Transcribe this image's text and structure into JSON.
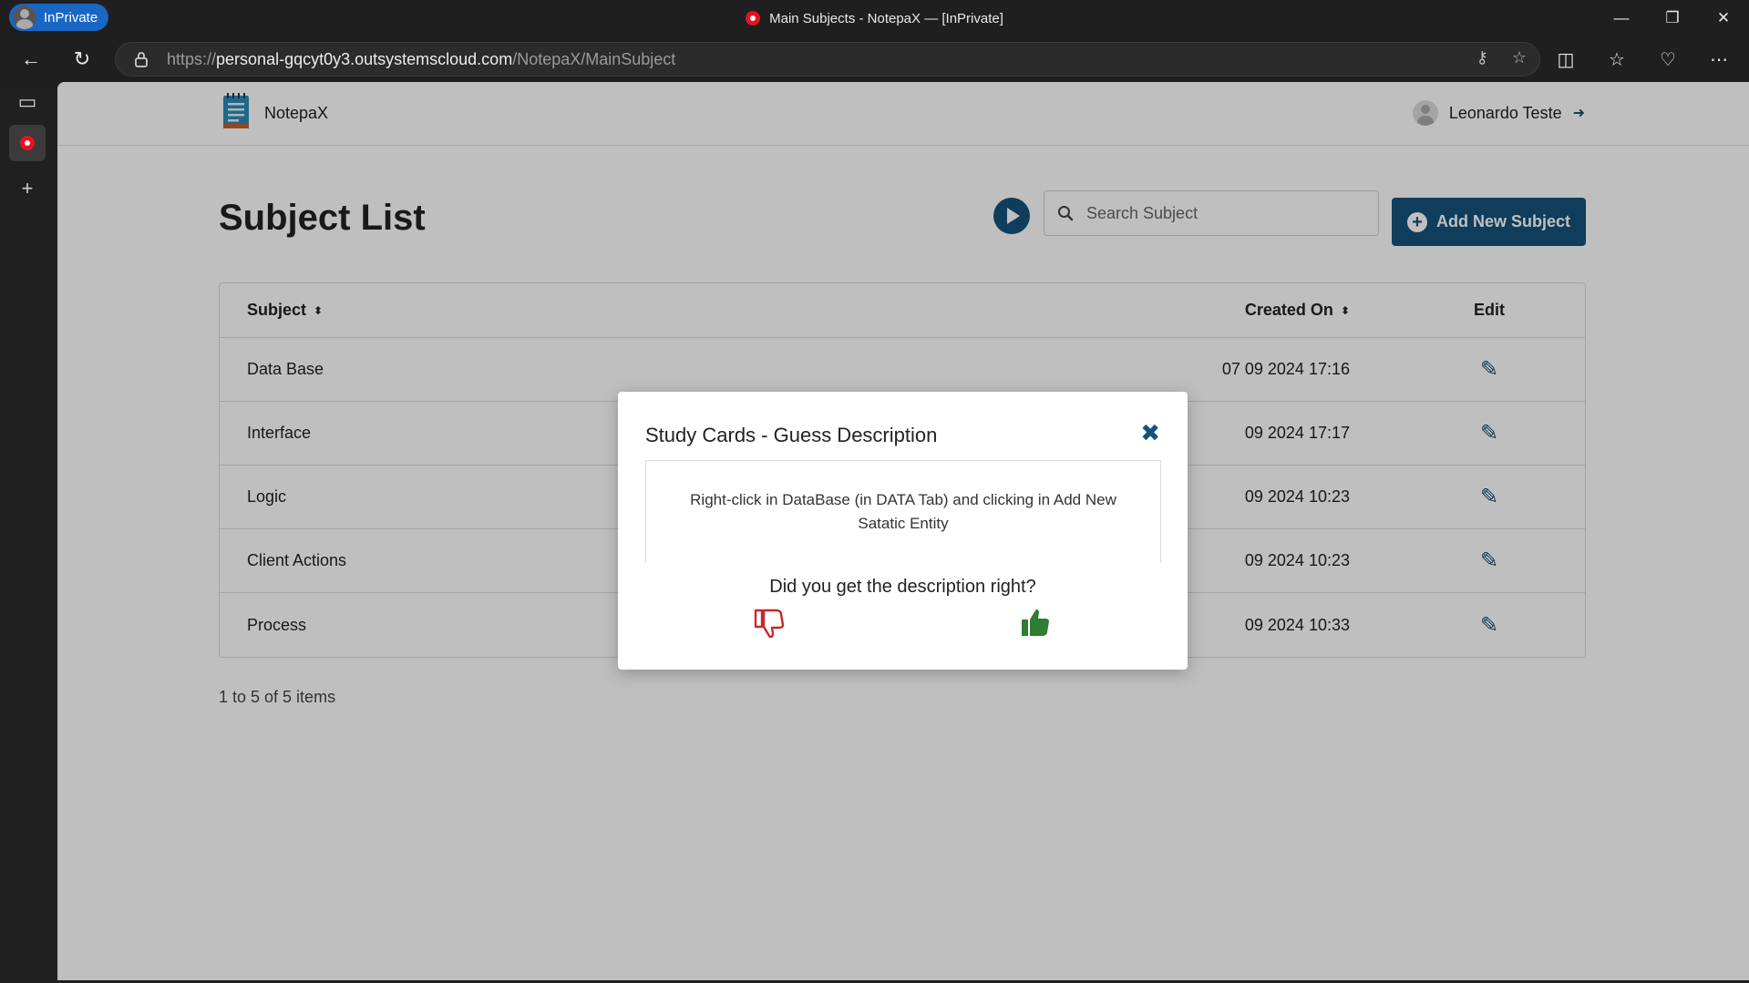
{
  "browser": {
    "inprivate_label": "InPrivate",
    "window_title": "Main Subjects - NotepaX — [InPrivate]",
    "url_prefix": "https://",
    "url_host": "personal-gqcyt0y3.outsystemscloud.com",
    "url_path": "/NotepaX/MainSubject"
  },
  "app": {
    "name": "NotepaX",
    "user_name": "Leonardo Teste"
  },
  "page": {
    "title": "Subject List",
    "search_placeholder": "Search Subject",
    "add_button_label": "Add New Subject"
  },
  "table": {
    "headers": {
      "subject": "Subject",
      "created_on": "Created On",
      "edit": "Edit"
    },
    "rows": [
      {
        "subject": "Data Base",
        "created_on": "07 09 2024 17:16"
      },
      {
        "subject": "Interface",
        "created_on": "09 2024 17:17"
      },
      {
        "subject": "Logic",
        "created_on": "09 2024 10:23"
      },
      {
        "subject": "Client Actions",
        "created_on": "09 2024 10:23"
      },
      {
        "subject": "Process",
        "created_on": "09 2024 10:33"
      }
    ],
    "pager_text": "1 to 5 of 5 items"
  },
  "modal": {
    "title": "Study Cards - Guess Description",
    "card_text": "Right-click in DataBase (in DATA Tab) and clicking in Add New Satatic Entity",
    "question": "Did you get the description right?"
  },
  "colors": {
    "primary": "#14527a",
    "thumb_down": "#c62828",
    "thumb_up": "#2e7d32"
  }
}
